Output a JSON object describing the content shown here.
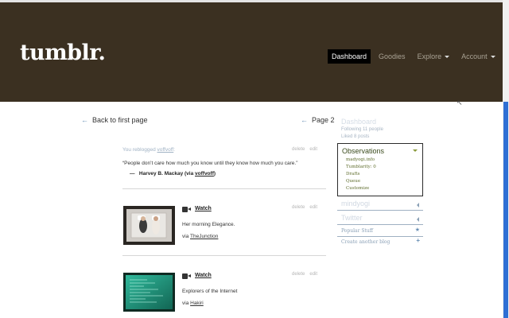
{
  "header": {
    "logo": "tumblr.",
    "nav": [
      {
        "label": "Dashboard",
        "active": true,
        "dropdown": false
      },
      {
        "label": "Goodies",
        "active": false,
        "dropdown": false
      },
      {
        "label": "Explore",
        "active": false,
        "dropdown": true
      },
      {
        "label": "Account",
        "active": false,
        "dropdown": true
      }
    ]
  },
  "pagination": {
    "back_label": "Back to first page",
    "page_label": "Page 2"
  },
  "posts": {
    "quote_post": {
      "meta_prefix": "You reblogged ",
      "meta_user": "voffvoff",
      "meta_suffix": ":",
      "delete": "delete",
      "edit": "edit",
      "quote": "“People don’t care how much you know until they know how much you care.”",
      "source_dash": "—",
      "source_name": "Harvey B. Mackay (via ",
      "source_link": "voffvoff",
      "source_end": ")"
    },
    "video_1": {
      "watch": "Watch",
      "delete": "delete",
      "edit": "edit",
      "caption": "Her morning Elegance.",
      "via": "via ",
      "via_link": "TheJunction"
    },
    "video_2": {
      "watch": "Watch",
      "delete": "delete",
      "edit": "edit",
      "caption": "Explorers of the Internet",
      "via": "via ",
      "via_link": "Hakiri"
    }
  },
  "sidebar": {
    "dashboard_title": "Dashboard",
    "following": "Following 11 people",
    "liked": "Liked 8 posts",
    "blog_box": {
      "title": "Observations",
      "items": [
        "madyogi.info",
        "Tumblarity: 0",
        "Drafts",
        "Queue",
        "Customize"
      ]
    },
    "rows": [
      {
        "label": "mindyogi"
      },
      {
        "label": "Twitter"
      },
      {
        "label": "Popular Stuff"
      },
      {
        "label": "Create another blog"
      }
    ]
  },
  "colors": {
    "header_bg": "#3b3021",
    "accent_blue": "#2e6fd4",
    "blog_box_text": "#5d6b2a"
  }
}
